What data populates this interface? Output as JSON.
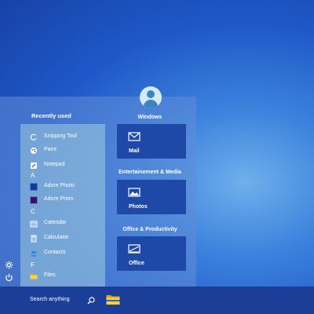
{
  "start_menu": {
    "recent_title": "Recently used",
    "apps": [
      {
        "label": "Snipping Tool",
        "icon": "snipping-tool-icon"
      },
      {
        "label": "Paint",
        "icon": "paint-icon"
      },
      {
        "label": "Notepad",
        "icon": "notepad-icon"
      },
      {
        "letter": "A"
      },
      {
        "label": "Adore Photo",
        "icon": "adore-photo-icon"
      },
      {
        "label": "Adore Prom",
        "icon": "adore-prom-icon"
      },
      {
        "letter": "C"
      },
      {
        "label": "Calendar",
        "icon": "calendar-icon"
      },
      {
        "label": "Calculator",
        "icon": "calculator-icon"
      },
      {
        "label": "Contacts",
        "icon": "contacts-icon"
      },
      {
        "letter": "F"
      },
      {
        "label": "Files",
        "icon": "files-icon"
      }
    ],
    "sections": [
      {
        "title": "Windows",
        "tile_label": "Mail",
        "tile_icon": "mail-icon"
      },
      {
        "title": "Entertainement & Media",
        "tile_label": "Photos",
        "tile_icon": "photos-icon"
      },
      {
        "title": "Office & Productivity",
        "tile_label": "Office",
        "tile_icon": "office-icon"
      }
    ],
    "side_icons": [
      "settings-icon",
      "power-icon"
    ]
  },
  "taskbar": {
    "search_text": "Search anything",
    "search_icon": "search-icon",
    "pinned": [
      "files-folder-icon"
    ]
  },
  "colors": {
    "panel": "#608cd7",
    "tile": "#1f49a8",
    "taskbar": "#1b3f99",
    "folder": "#f5b800"
  }
}
